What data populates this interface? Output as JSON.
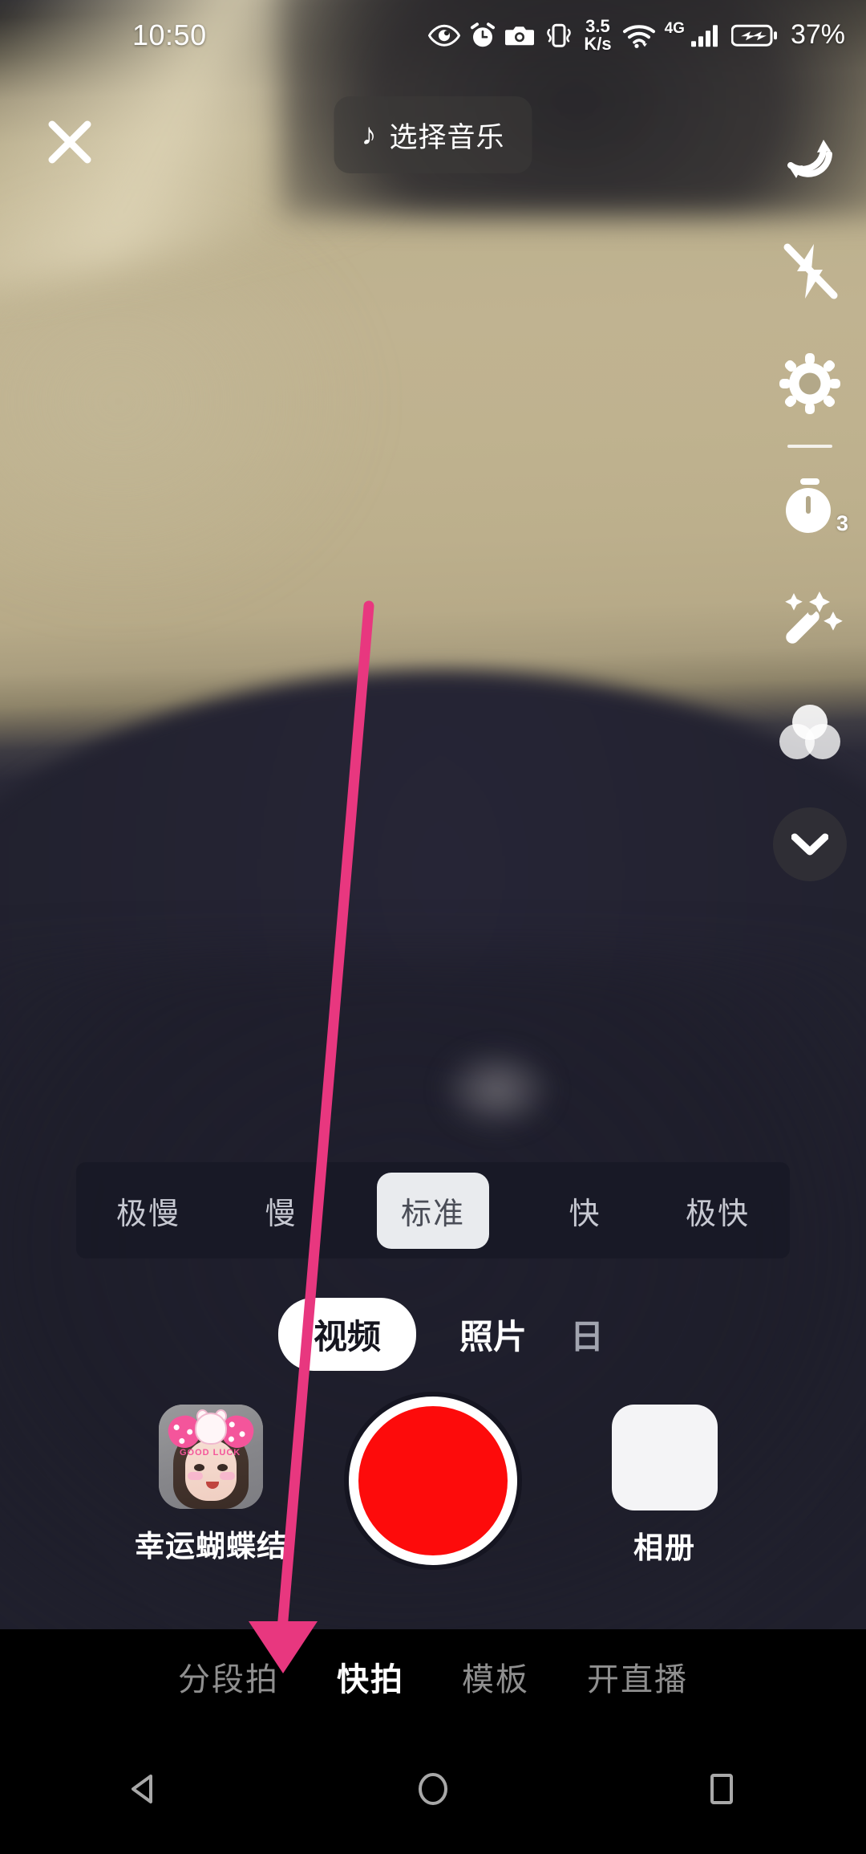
{
  "status_bar": {
    "time": "10:50",
    "icons": [
      "eye-comfort-icon",
      "alarm-icon",
      "camera-icon",
      "vibrate-icon"
    ],
    "network_speed_value": "3.5",
    "network_speed_unit": "K/s",
    "wifi_icon": "wifi-icon",
    "mobile_network": "4G",
    "signal_icon": "signal-bars-icon",
    "battery_icon": "battery-charging-icon",
    "battery_percent": "37%"
  },
  "top_bar": {
    "close_icon": "close-icon",
    "music_icon": "music-note-icon",
    "music_label": "选择音乐"
  },
  "side_rail": {
    "items": [
      {
        "icon": "flip-camera-icon",
        "name": "flip-camera"
      },
      {
        "icon": "flash-off-icon",
        "name": "flash-off"
      },
      {
        "icon": "settings-gear-icon",
        "name": "settings"
      },
      {
        "icon": "divider",
        "name": "rail-divider"
      },
      {
        "icon": "timer-icon",
        "name": "timer",
        "badge": "3"
      },
      {
        "icon": "beauty-wand-icon",
        "name": "beauty"
      },
      {
        "icon": "filters-icon",
        "name": "filters"
      },
      {
        "icon": "chevron-down-icon",
        "name": "collapse-rail"
      }
    ]
  },
  "speed_bar": {
    "options": [
      "极慢",
      "慢",
      "标准",
      "快",
      "极快"
    ],
    "selected_index": 2
  },
  "mode_tabs": {
    "tabs": [
      "视频",
      "照片",
      "日"
    ],
    "selected_index": 0
  },
  "capture_row": {
    "effect_label": "幸运蝴蝶结",
    "effect_thumb_name": "effect-thumbnail",
    "record_button_name": "record-button",
    "record_button_color": "#fd0b0b",
    "album_label": "相册",
    "album_thumb_name": "album-thumbnail"
  },
  "shoot_nav": {
    "items": [
      "分段拍",
      "快拍",
      "模板",
      "开直播"
    ],
    "selected_index": 1
  },
  "android_nav": {
    "back_icon": "back-triangle-icon",
    "home_icon": "home-circle-icon",
    "recents_icon": "recents-square-icon"
  },
  "annotation": {
    "arrow_color": "#e8377f",
    "arrow_points_to": "分段拍"
  }
}
